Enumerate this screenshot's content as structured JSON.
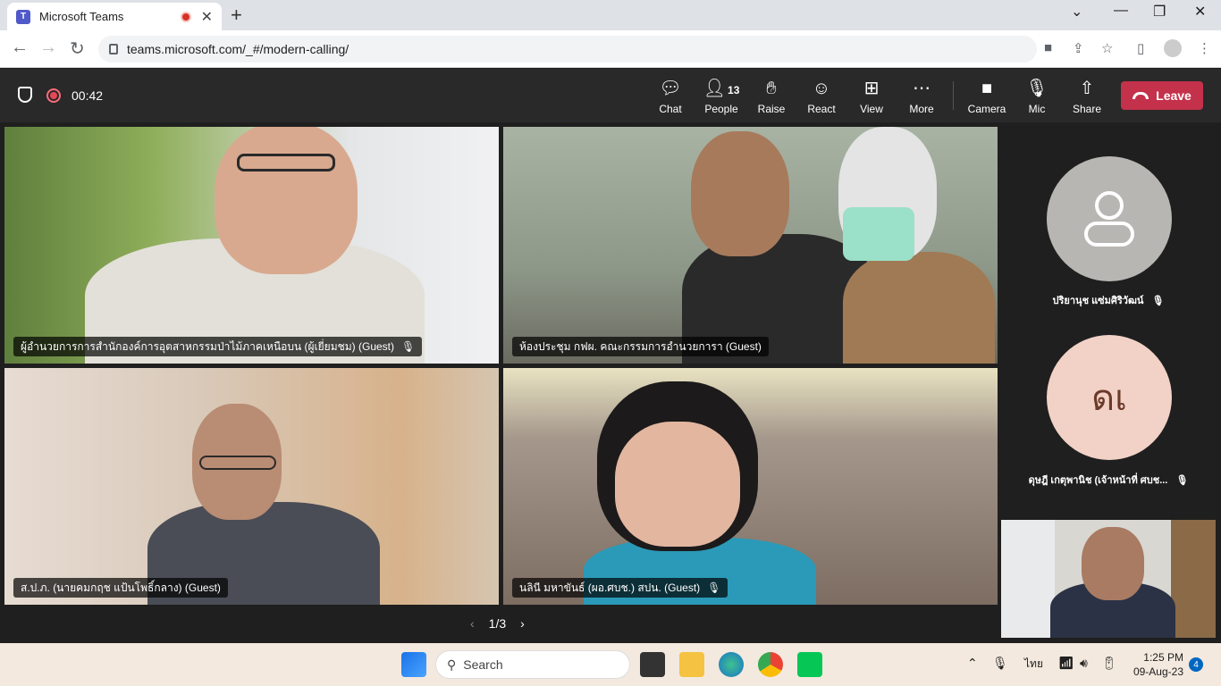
{
  "browser": {
    "tab_title": "Microsoft Teams",
    "url": "teams.microsoft.com/_#/modern-calling/"
  },
  "meeting": {
    "timer": "00:42",
    "controls": {
      "chat": "Chat",
      "people": "People",
      "people_count": "13",
      "raise": "Raise",
      "react": "React",
      "view": "View",
      "more": "More",
      "camera": "Camera",
      "mic": "Mic",
      "share": "Share",
      "leave": "Leave"
    }
  },
  "participants": [
    {
      "name": "ผู้อำนวยการการสำนักองค์การอุตสาหกรรมป่าไม้ภาคเหนือบน (ผู้เยี่ยมชม) (Guest)"
    },
    {
      "name": "ห้องประชุม กฟผ. คณะกรรมการอำนวยการา (Guest)"
    },
    {
      "name": "ส.ป.ภ. (นายคมกฤช แป้นโพธิ์กลาง) (Guest)"
    },
    {
      "name": "นลินี มหาขันธ์ (ผอ.ศบช.) สปน. (Guest)"
    }
  ],
  "side_participants": [
    {
      "name": "ปริยานุช แซ่มศิริวัฒน์",
      "initials": ""
    },
    {
      "name": "ดุษฎี เกตุพานิช (เจ้าหน้าที่ ศบช...",
      "initials": "ดเ"
    }
  ],
  "pager": "1/3",
  "taskbar": {
    "search_placeholder": "Search",
    "lang": "ไทย",
    "time": "1:25 PM",
    "date": "09-Aug-23",
    "notifications": "4"
  }
}
